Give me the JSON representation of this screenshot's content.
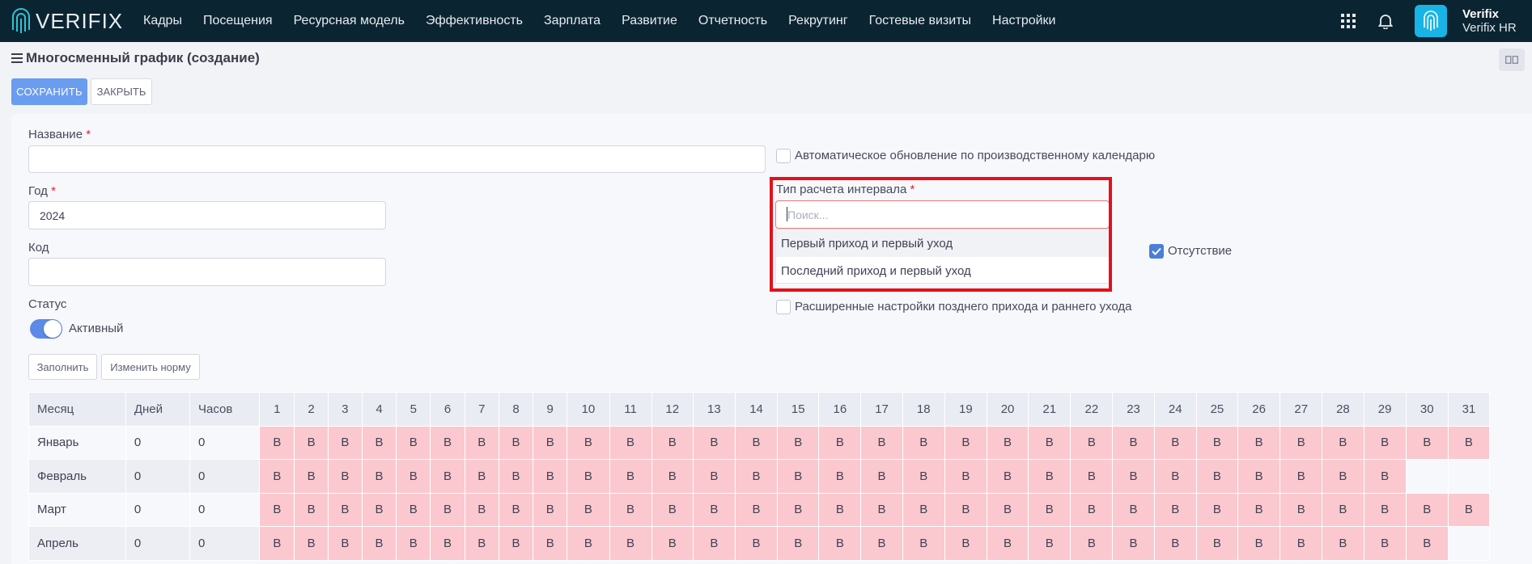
{
  "brand": {
    "logo_text": "VERIFIX"
  },
  "menu": [
    "Кадры",
    "Посещения",
    "Ресурсная модель",
    "Эффективность",
    "Зарплата",
    "Развитие",
    "Отчетность",
    "Рекрутинг",
    "Гостевые визиты",
    "Настройки"
  ],
  "user": {
    "name": "Verifix",
    "company": "Verifix HR"
  },
  "page": {
    "title": "Многосменный график (создание)"
  },
  "actions": {
    "save": "СОХРАНИТЬ",
    "close": "ЗАКРЫТЬ"
  },
  "form": {
    "name": {
      "label": "Название",
      "value": ""
    },
    "year": {
      "label": "Год",
      "value": "2024"
    },
    "code": {
      "label": "Код",
      "value": ""
    },
    "status": {
      "label": "Статус",
      "value": "Активный",
      "enabled": true
    },
    "fill_button": "Заполнить",
    "norm_button": "Изменить норму",
    "auto_update": {
      "label": "Автоматическое обновление по производственному календарю",
      "checked": false
    },
    "interval_type": {
      "label": "Тип расчета интервала",
      "placeholder": "Поиск...",
      "options": [
        "Первый приход и первый уход",
        "Последний приход и первый уход"
      ]
    },
    "absence": {
      "label": "Отсутствие",
      "checked": true
    },
    "advanced": {
      "label": "Расширенные настройки позднего прихода и раннего ухода",
      "checked": false
    }
  },
  "calendar": {
    "headers": {
      "month": "Месяц",
      "days": "Дней",
      "hours": "Часов"
    },
    "day_numbers": [
      "1",
      "2",
      "3",
      "4",
      "5",
      "6",
      "7",
      "8",
      "9",
      "10",
      "11",
      "12",
      "13",
      "14",
      "15",
      "16",
      "17",
      "18",
      "19",
      "20",
      "21",
      "22",
      "23",
      "24",
      "25",
      "26",
      "27",
      "28",
      "29",
      "30",
      "31"
    ],
    "cell_mark": "В",
    "rows": [
      {
        "month": "Январь",
        "days": "0",
        "hours": "0",
        "day_count": 31
      },
      {
        "month": "Февраль",
        "days": "0",
        "hours": "0",
        "day_count": 29
      },
      {
        "month": "Март",
        "days": "0",
        "hours": "0",
        "day_count": 31
      },
      {
        "month": "Апрель",
        "days": "0",
        "hours": "0",
        "day_count": 30
      }
    ]
  },
  "colors": {
    "navbar": "#0b2431",
    "primary": "#6a9cf0",
    "weekend_cell": "#fbc8cf",
    "highlight": "#e4101b"
  }
}
